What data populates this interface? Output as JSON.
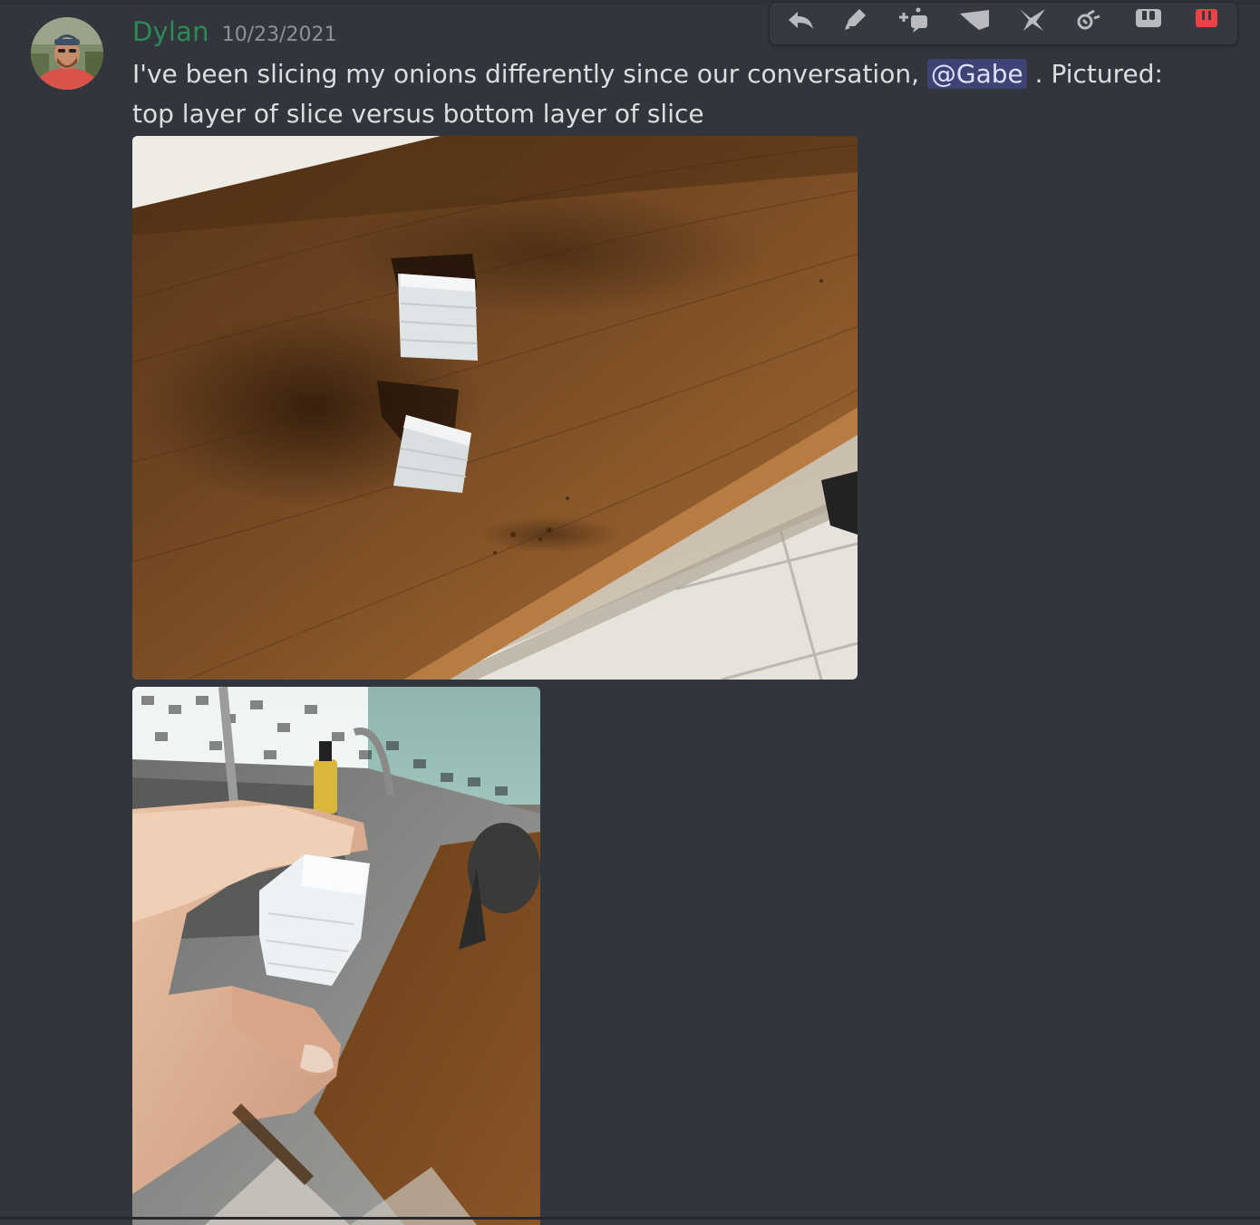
{
  "message": {
    "author": "Dylan",
    "timestamp": "10/23/2021",
    "text_before": "I've been slicing my onions differently since our conversation, ",
    "mention": "@Gabe",
    "text_after": " . Pictured: top layer of slice versus bottom layer of slice"
  },
  "toolbar": {
    "actions": [
      "reply-icon",
      "edit-icon",
      "add-reaction-icon",
      "forward-icon",
      "pin-icon",
      "thread-icon",
      "mark-icon",
      "delete-icon"
    ]
  },
  "colors": {
    "background": "#32353b",
    "username": "#2d8a55",
    "mention_bg": "#4a4f8a",
    "delete": "#ed4245"
  }
}
